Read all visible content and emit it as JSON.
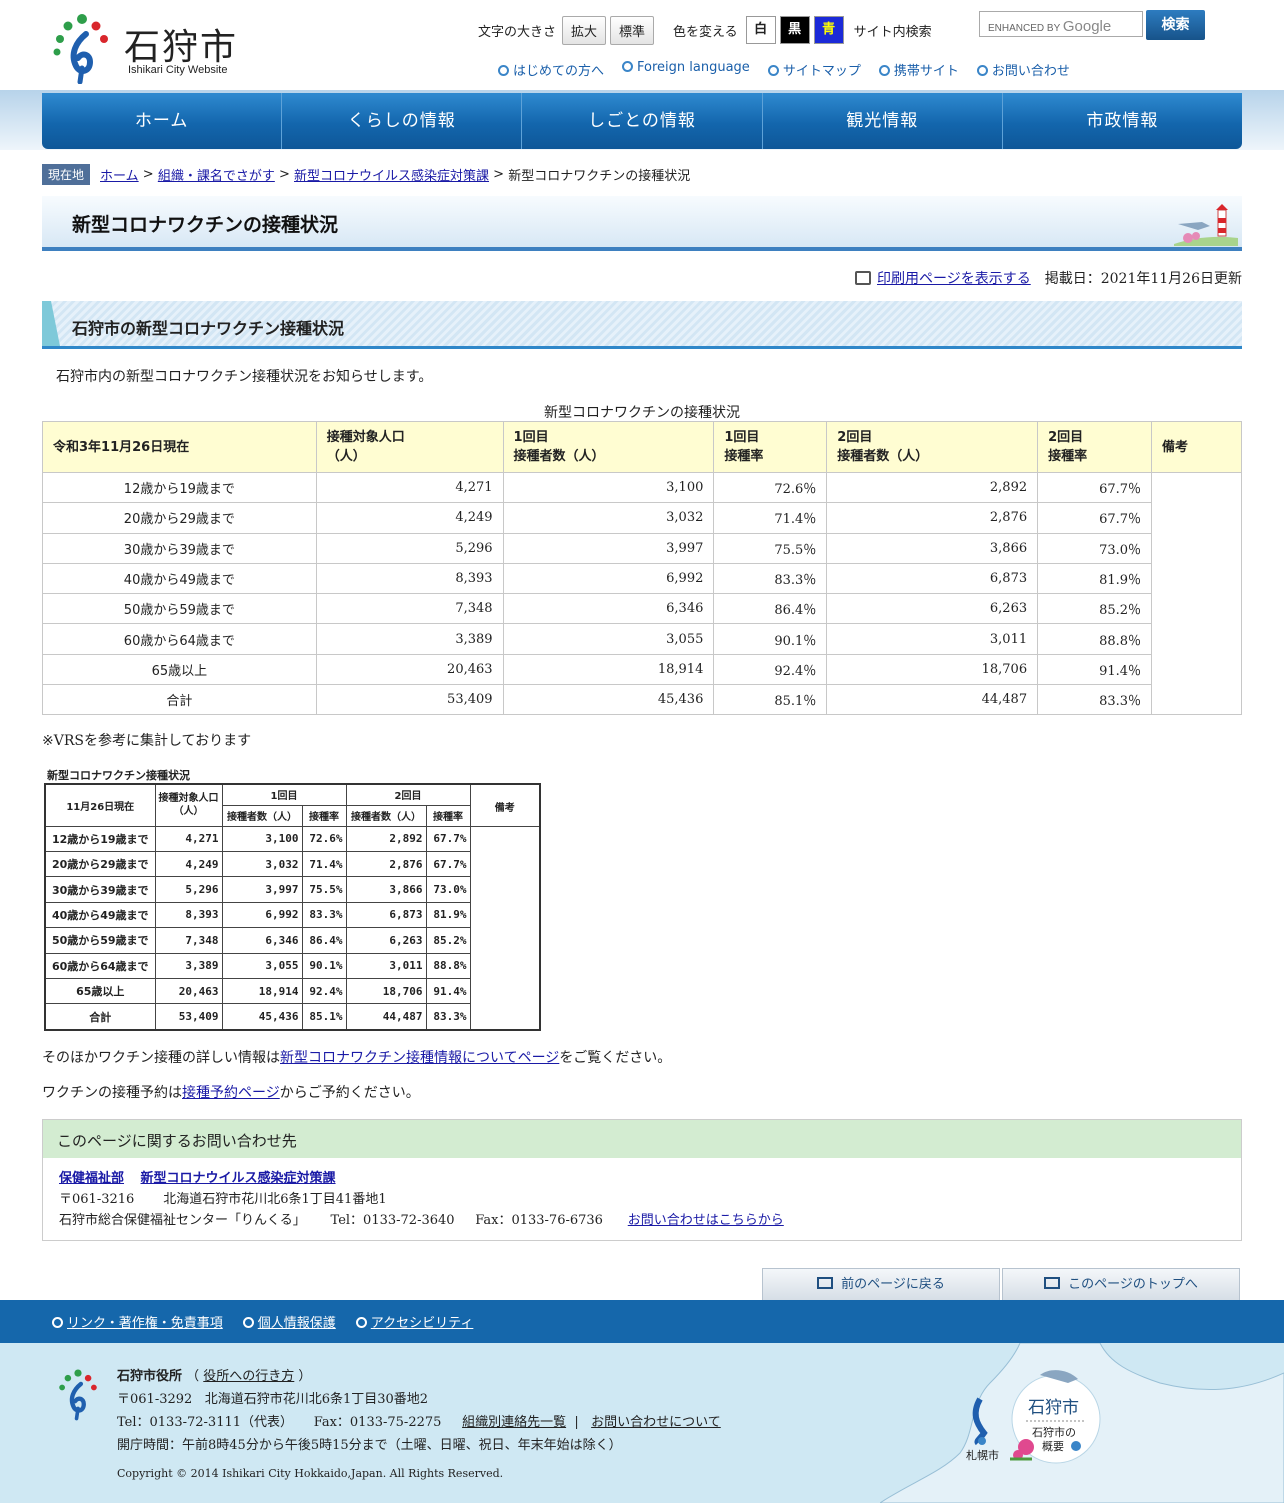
{
  "header": {
    "site_name": "石狩市",
    "site_sub": "Ishikari City Website",
    "font_size_label": "文字の大きさ",
    "enlarge": "拡大",
    "standard": "標準",
    "color_label": "色を変える",
    "color_white": "白",
    "color_black": "黒",
    "color_blue": "青",
    "site_search_label": "サイト内検索",
    "search_placeholder_prefix": "ENHANCED BY",
    "search_placeholder_brand": "Google",
    "search_button": "検索",
    "sublinks": [
      "はじめての方へ",
      "Foreign language",
      "サイトマップ",
      "携帯サイト",
      "お問い合わせ"
    ]
  },
  "nav": [
    "ホーム",
    "くらしの情報",
    "しごとの情報",
    "観光情報",
    "市政情報"
  ],
  "breadcrumb": {
    "here": "現在地",
    "items": [
      "ホーム",
      "組織・課名でさがす",
      "新型コロナウイルス感染症対策課"
    ],
    "current": "新型コロナワクチンの接種状況"
  },
  "page_title": "新型コロナワクチンの接種状況",
  "print_link": "印刷用ページを表示する",
  "published": "掲載日：2021年11月26日更新",
  "section_title": "石狩市の新型コロナワクチン接種状況",
  "intro": "石狩市内の新型コロナワクチン接種状況をお知らせします。",
  "table": {
    "caption": "新型コロナワクチンの接種状況",
    "headers": [
      "令和3年11月26日現在",
      "接種対象人口\n（人）",
      "1回目\n接種者数（人）",
      "1回目\n接種率",
      "2回目\n接種者数（人）",
      "2回目\n接種率",
      "備考"
    ],
    "rows": [
      [
        "12歳から19歳まで",
        "4,271",
        "3,100",
        "72.6％",
        "2,892",
        "67.7％"
      ],
      [
        "20歳から29歳まで",
        "4,249",
        "3,032",
        "71.4％",
        "2,876",
        "67.7％"
      ],
      [
        "30歳から39歳まで",
        "5,296",
        "3,997",
        "75.5％",
        "3,866",
        "73.0％"
      ],
      [
        "40歳から49歳まで",
        "8,393",
        "6,992",
        "83.3％",
        "6,873",
        "81.9％"
      ],
      [
        "50歳から59歳まで",
        "7,348",
        "6,346",
        "86.4％",
        "6,263",
        "85.2％"
      ],
      [
        "60歳から64歳まで",
        "3,389",
        "3,055",
        "90.1％",
        "3,011",
        "88.8％"
      ],
      [
        "65歳以上",
        "20,463",
        "18,914",
        "92.4％",
        "18,706",
        "91.4％"
      ],
      [
        "合計",
        "53,409",
        "45,436",
        "85.1％",
        "44,487",
        "83.3％"
      ]
    ]
  },
  "note_vrs": "※VRSを参考に集計しております",
  "image_table": {
    "title": "新型コロナワクチン接種状況",
    "h_date": "11月26日現在",
    "h_pop": "接種対象人口\n（人）",
    "h_first": "1回目",
    "h_second": "2回目",
    "h_remarks": "備考",
    "h_count": "接種者数（人）",
    "h_rate": "接種率",
    "rows": [
      [
        "12歳から19歳まで",
        "4,271",
        "3,100",
        "72.6%",
        "2,892",
        "67.7%"
      ],
      [
        "20歳から29歳まで",
        "4,249",
        "3,032",
        "71.4%",
        "2,876",
        "67.7%"
      ],
      [
        "30歳から39歳まで",
        "5,296",
        "3,997",
        "75.5%",
        "3,866",
        "73.0%"
      ],
      [
        "40歳から49歳まで",
        "8,393",
        "6,992",
        "83.3%",
        "6,873",
        "81.9%"
      ],
      [
        "50歳から59歳まで",
        "7,348",
        "6,346",
        "86.4%",
        "6,263",
        "85.2%"
      ],
      [
        "60歳から64歳まで",
        "3,389",
        "3,055",
        "90.1%",
        "3,011",
        "88.8%"
      ],
      [
        "65歳以上",
        "20,463",
        "18,914",
        "92.4%",
        "18,706",
        "91.4%"
      ],
      [
        "合計",
        "53,409",
        "45,436",
        "85.1%",
        "44,487",
        "83.3%"
      ]
    ]
  },
  "more_info": {
    "before": "そのほかワクチン接種の詳しい情報は",
    "link": "新型コロナワクチン接種情報についてページ",
    "after": "をご覧ください。"
  },
  "reserve": {
    "before": "ワクチンの接種予約は",
    "link": "接種予約ページ",
    "after": "からご予約ください。"
  },
  "contact": {
    "heading": "このページに関するお問い合わせ先",
    "dept": "保健福祉部",
    "section": "新型コロナウイルス感染症対策課",
    "postal": "〒061-3216",
    "address": "北海道石狩市花川北6条1丁目41番地1",
    "facility": "石狩市総合保健福祉センター「りんくる」",
    "tel": "Tel：0133-72-3640",
    "fax": "Fax：0133-76-6736",
    "inquiry_link": "お問い合わせはこちらから"
  },
  "back": {
    "prev": "前のページに戻る",
    "top": "このページのトップへ"
  },
  "footer": {
    "links": [
      "リンク・著作権・免責事項",
      "個人情報保護",
      "アクセシビリティ"
    ],
    "office": "石狩市役所",
    "directions": "役所への行き方",
    "postal": "〒061-3292",
    "address": "北海道石狩市花川北6条1丁目30番地2",
    "tel": "Tel：0133-72-3111（代表）",
    "fax": "Fax：0133-75-2275",
    "contact_list": "組織別連絡先一覧",
    "about_inquiry": "お問い合わせについて",
    "hours": "開庁時間：午前8時45分から午後5時15分まで（土曜、日曜、祝日、年末年始は除く）",
    "copyright": "Copyright © 2014 Ishikari City Hokkaido,Japan. All Rights Reserved.",
    "map_city": "石狩市",
    "map_overview_1": "石狩市の",
    "map_overview_2": "概要",
    "map_sapporo": "札幌市"
  },
  "colors": {
    "nav": "#1366ad",
    "table_header": "#fffdd2",
    "contact_head": "#d3ecd1",
    "footer_bar": "#1567ab",
    "footer_bg": "#cfe8f3"
  }
}
